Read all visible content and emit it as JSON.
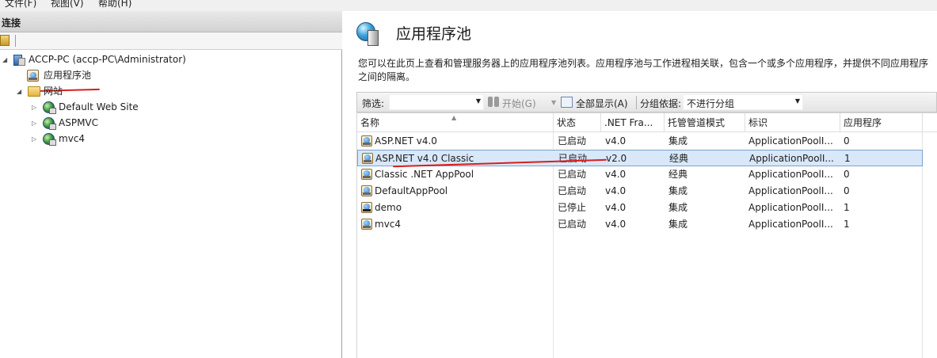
{
  "menu": {
    "items": [
      "文件(F)",
      "视图(V)",
      "帮助(H)"
    ]
  },
  "connections": {
    "header": "连接",
    "tree": {
      "server": "ACCP-PC (accp-PC\\Administrator)",
      "app_pools": "应用程序池",
      "sites": "网站",
      "site_items": [
        "Default Web Site",
        "ASPMVC",
        "mvc4"
      ]
    }
  },
  "main": {
    "title": "应用程序池",
    "description": "您可以在此页上查看和管理服务器上的应用程序池列表。应用程序池与工作进程相关联，包含一个或多个应用程序，并提供不同应用程序之间的隔离。",
    "filterbar": {
      "filter_label": "筛选:",
      "filter_value": "",
      "start_label": "开始(G)",
      "show_all_label": "全部显示(A)",
      "group_label": "分组依据:",
      "group_value": "不进行分组"
    },
    "columns": [
      "名称",
      "状态",
      ".NET Fra...",
      "托管管道模式",
      "标识",
      "应用程序"
    ],
    "rows": [
      {
        "name": "ASP.NET v4.0",
        "status": "已启动",
        "net": "v4.0",
        "mode": "集成",
        "identity": "ApplicationPoolI...",
        "apps": "0",
        "selected": false,
        "stopped": false
      },
      {
        "name": "ASP.NET v4.0 Classic",
        "status": "已启动",
        "net": "v2.0",
        "mode": "经典",
        "identity": "ApplicationPoolI...",
        "apps": "1",
        "selected": true,
        "stopped": false
      },
      {
        "name": "Classic .NET AppPool",
        "status": "已启动",
        "net": "v4.0",
        "mode": "经典",
        "identity": "ApplicationPoolI...",
        "apps": "0",
        "selected": false,
        "stopped": false
      },
      {
        "name": "DefaultAppPool",
        "status": "已启动",
        "net": "v4.0",
        "mode": "集成",
        "identity": "ApplicationPoolI...",
        "apps": "0",
        "selected": false,
        "stopped": false
      },
      {
        "name": "demo",
        "status": "已停止",
        "net": "v4.0",
        "mode": "集成",
        "identity": "ApplicationPoolI...",
        "apps": "1",
        "selected": false,
        "stopped": true
      },
      {
        "name": "mvc4",
        "status": "已启动",
        "net": "v4.0",
        "mode": "集成",
        "identity": "ApplicationPoolI...",
        "apps": "1",
        "selected": false,
        "stopped": false
      }
    ]
  },
  "colors": {
    "annotation": "#d81e1e",
    "selection": "#d8e8f9",
    "selection_border": "#7da2ce"
  },
  "icons": {
    "server": "server-icon",
    "app_pool": "app-pool-icon",
    "sites_folder": "folder-icon",
    "site": "globe-icon",
    "title": "app-pools-title-icon"
  }
}
